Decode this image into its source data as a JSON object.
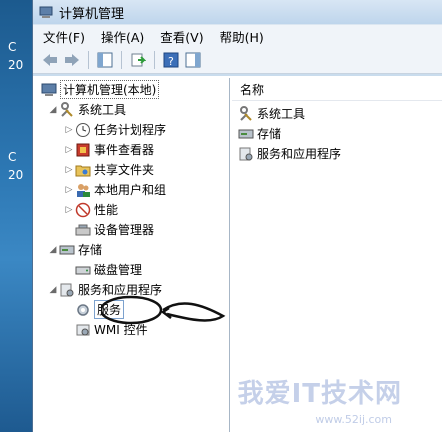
{
  "desktop": {
    "items": [
      "C",
      "20",
      "C",
      "20"
    ]
  },
  "window": {
    "title": "计算机管理"
  },
  "menu": [
    "文件(F)",
    "操作(A)",
    "查看(V)",
    "帮助(H)"
  ],
  "tree": {
    "root": "计算机管理(本地)",
    "system_tools": "系统工具",
    "task_scheduler": "任务计划程序",
    "event_viewer": "事件查看器",
    "shared_folders": "共享文件夹",
    "local_users": "本地用户和组",
    "performance": "性能",
    "device_manager": "设备管理器",
    "storage": "存储",
    "disk_management": "磁盘管理",
    "services_apps": "服务和应用程序",
    "services": "服务",
    "wmi": "WMI 控件"
  },
  "list": {
    "header": "名称",
    "items": [
      "系统工具",
      "存储",
      "服务和应用程序"
    ]
  },
  "watermark": {
    "text": "我爱IT技术网",
    "url": "www.52ij.com"
  }
}
